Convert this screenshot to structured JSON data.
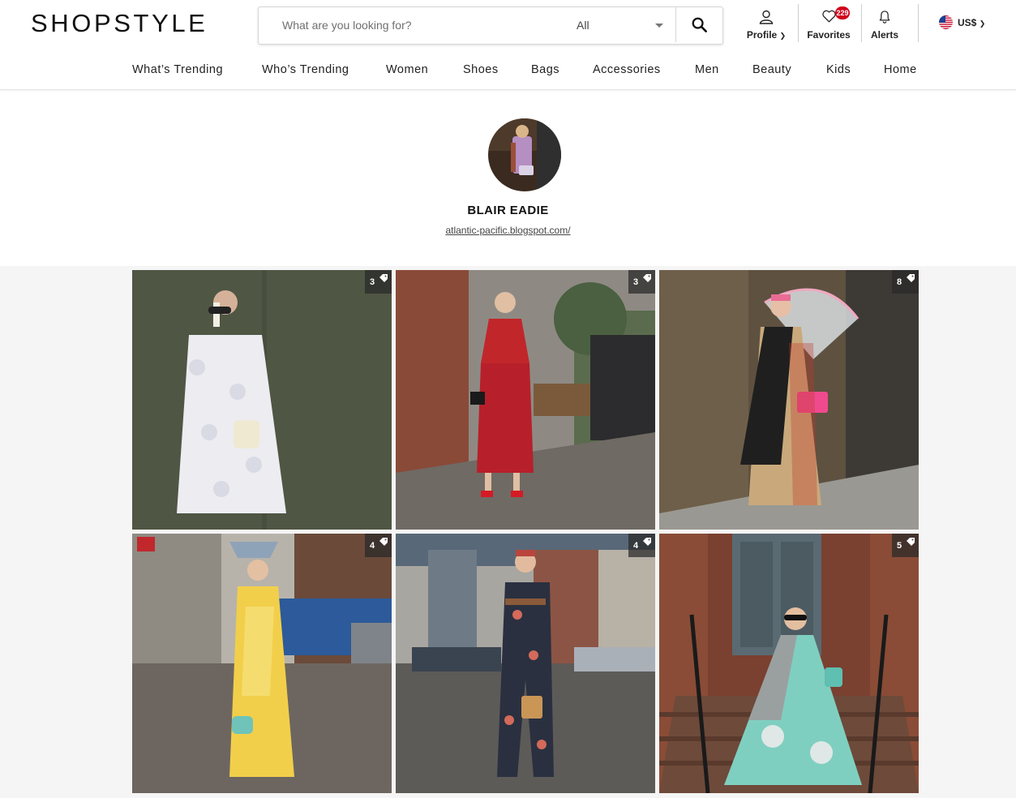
{
  "brand": {
    "logo_text": "SHOPSTYLE"
  },
  "search": {
    "placeholder": "What are you looking for?",
    "category_value": "All"
  },
  "header_actions": {
    "profile_label": "Profile",
    "favorites_label": "Favorites",
    "favorites_count": "229",
    "alerts_label": "Alerts",
    "currency_label": "US$"
  },
  "nav": {
    "items": [
      "What’s Trending",
      "Who’s Trending",
      "Women",
      "Shoes",
      "Bags",
      "Accessories",
      "Men",
      "Beauty",
      "Kids",
      "Home"
    ]
  },
  "profile": {
    "name": "BLAIR EADIE",
    "link": "atlantic-pacific.blogspot.com/"
  },
  "looks": [
    {
      "item_count": "3",
      "icon": "price-tag-icon"
    },
    {
      "item_count": "3",
      "icon": "price-tag-icon"
    },
    {
      "item_count": "8",
      "icon": "price-tag-icon"
    },
    {
      "item_count": "4",
      "icon": "price-tag-icon"
    },
    {
      "item_count": "4",
      "icon": "price-tag-icon"
    },
    {
      "item_count": "5",
      "icon": "price-tag-icon"
    }
  ],
  "colors": {
    "badge_red": "#d0021b",
    "gallery_bg": "#f5f5f5",
    "text_dark": "#222222"
  }
}
